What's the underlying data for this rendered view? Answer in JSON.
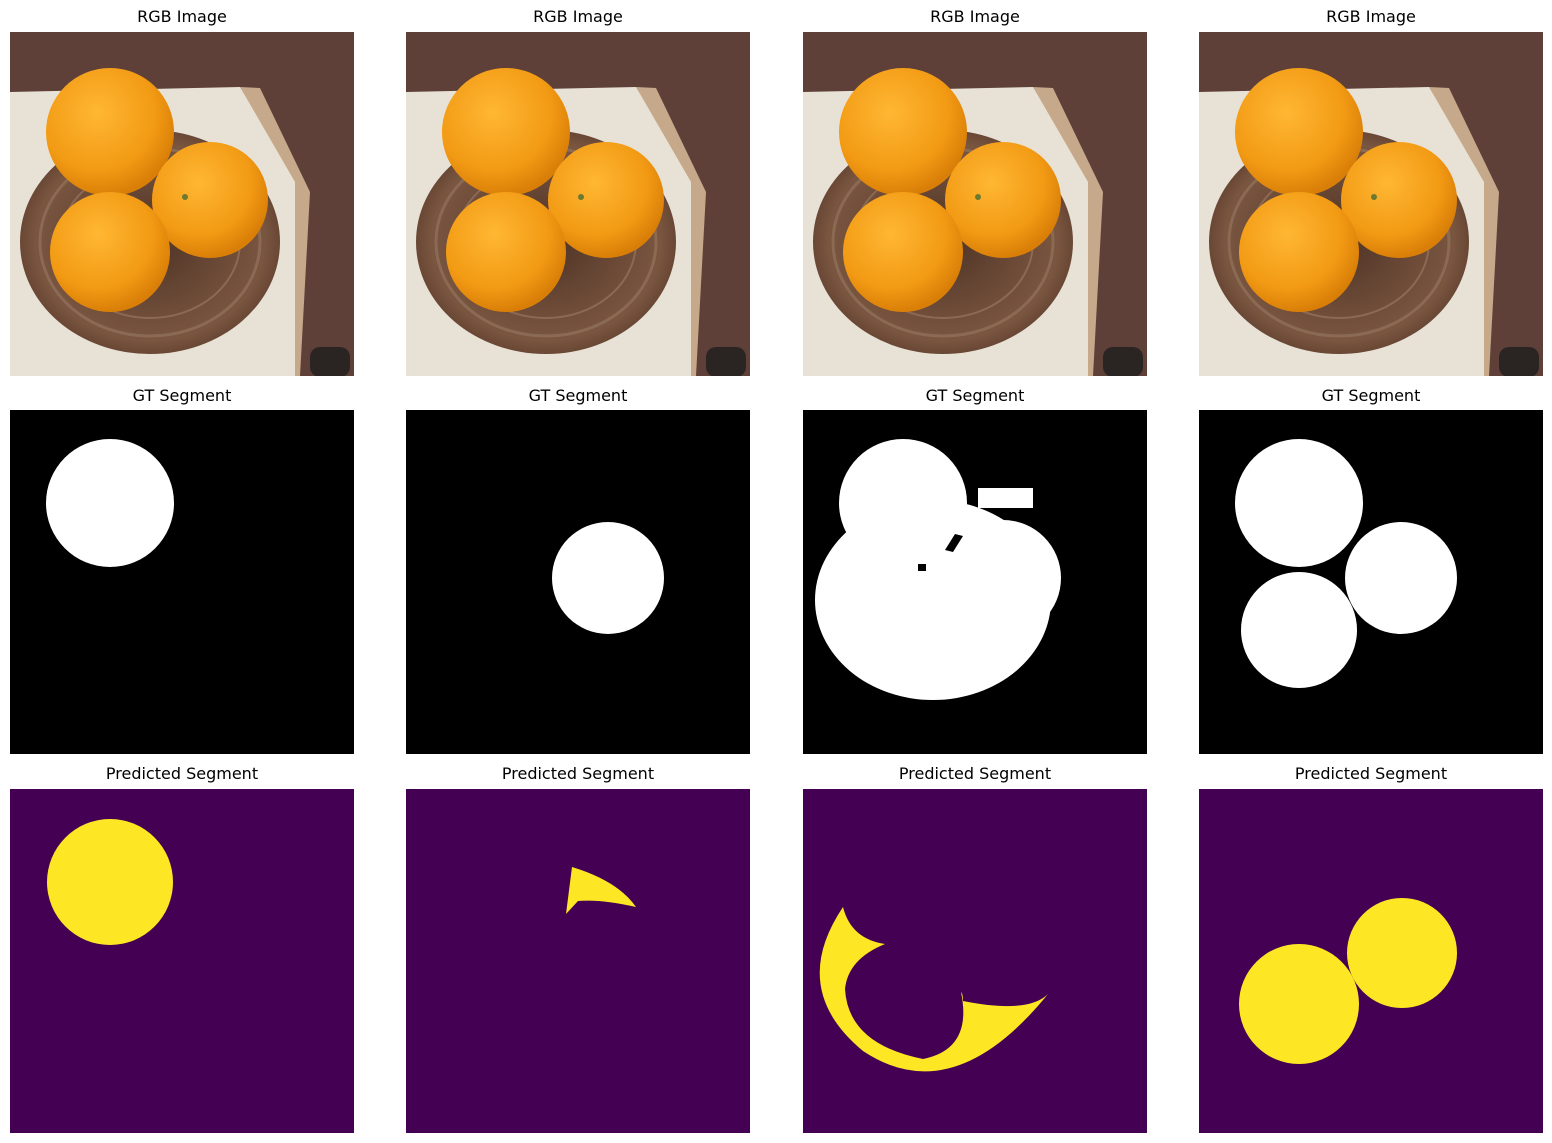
{
  "rows": {
    "rgb": {
      "title": "RGB Image"
    },
    "gt": {
      "title": "GT Segment"
    },
    "pred": {
      "title": "Predicted Segment"
    }
  },
  "columns": 4,
  "colors": {
    "background": "#ffffff",
    "gt_background": "#000000",
    "gt_foreground": "#ffffff",
    "pred_background": "#440154",
    "pred_foreground": "#fde725",
    "orange": "#f5a21c",
    "bowl": "#6e4a35",
    "counter": "#e6e0d4",
    "wood": "#5c4038"
  }
}
